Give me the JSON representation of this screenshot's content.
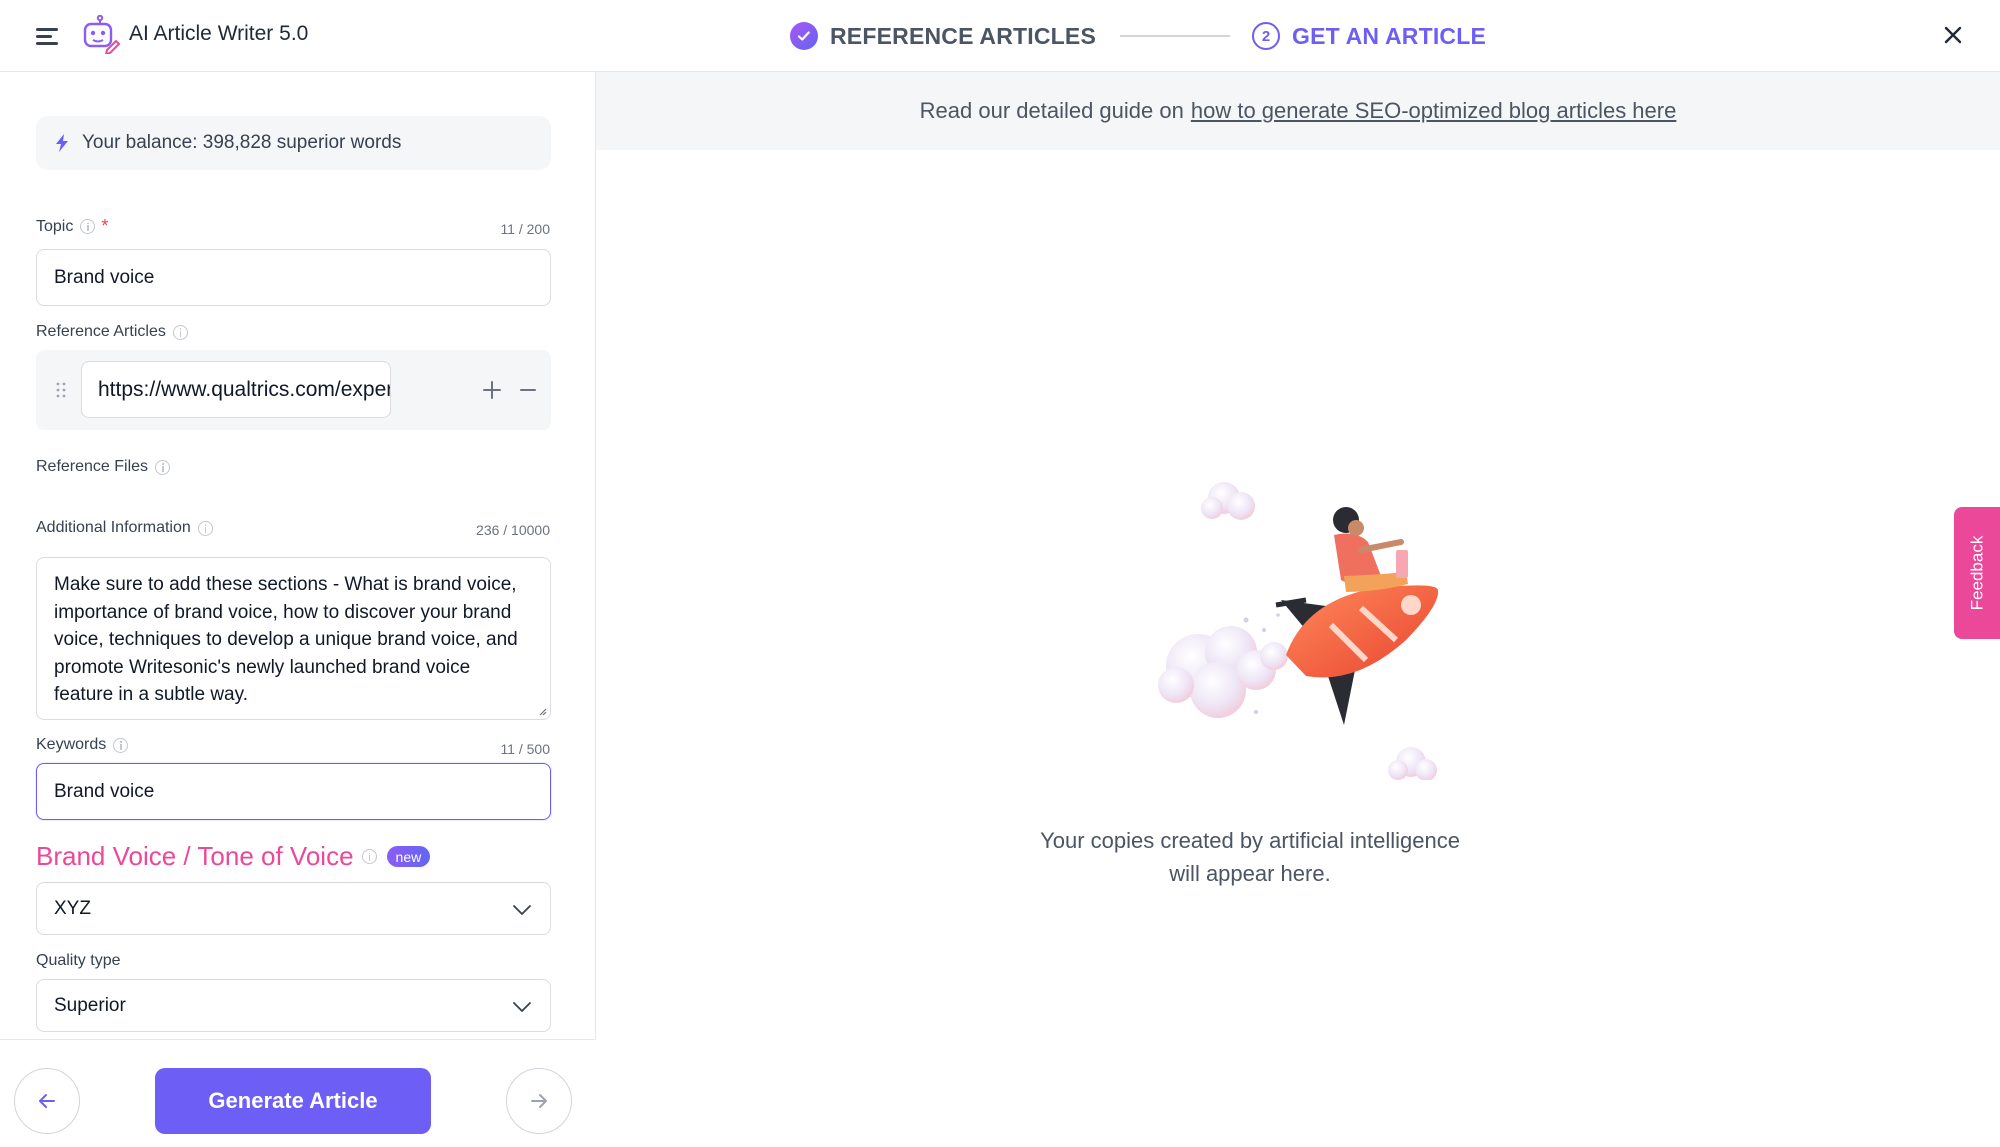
{
  "app": {
    "title": "AI Article Writer 5.0"
  },
  "stepper": {
    "step1_label": "REFERENCE ARTICLES",
    "step2_number": "2",
    "step2_label": "GET AN ARTICLE"
  },
  "balance": {
    "text": "Your balance: 398,828 superior words"
  },
  "form": {
    "topic": {
      "label": "Topic",
      "required_mark": "*",
      "counter": "11 / 200",
      "value": "Brand voice"
    },
    "reference_articles": {
      "label": "Reference Articles",
      "items": [
        "https://www.qualtrics.com/experience-management/brand/brand-voice/"
      ]
    },
    "reference_files": {
      "label": "Reference Files"
    },
    "additional_info": {
      "label": "Additional Information",
      "counter": "236 / 10000",
      "value": "Make sure to add these sections - What is brand voice, importance of brand voice, how to discover your brand voice, techniques to develop a unique brand voice, and promote Writesonic's newly launched brand voice feature in a subtle way."
    },
    "keywords": {
      "label": "Keywords",
      "counter": "11 / 500",
      "value": "Brand voice"
    },
    "brand_voice": {
      "label": "Brand Voice / Tone of Voice",
      "badge": "new",
      "selected": "XYZ"
    },
    "quality_type": {
      "label": "Quality type",
      "selected": "Superior"
    }
  },
  "actions": {
    "generate_label": "Generate Article"
  },
  "guide": {
    "prefix": "Read our detailed guide on",
    "link_text": "how to generate SEO-optimized blog articles here"
  },
  "empty_state": {
    "line1": "Your copies created by artificial intelligence",
    "line2": "will appear here."
  },
  "feedback": {
    "label": "Feedback"
  },
  "colors": {
    "accent": "#6d5ef5",
    "brand_pink": "#ec4899",
    "required": "#ef4444"
  },
  "icons": [
    "menu-icon",
    "robot-pen-icon",
    "check-icon",
    "close-icon",
    "bolt-icon",
    "info-icon",
    "drag-handle-icon",
    "plus-icon",
    "minus-icon",
    "chevron-down-icon",
    "arrow-left-icon",
    "arrow-right-icon"
  ]
}
